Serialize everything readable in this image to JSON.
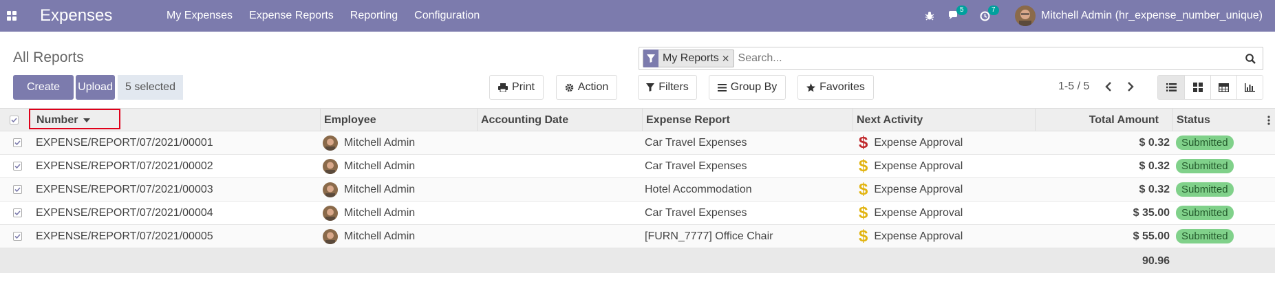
{
  "app": {
    "title": "Expenses"
  },
  "menu": [
    {
      "label": "My Expenses"
    },
    {
      "label": "Expense Reports"
    },
    {
      "label": "Reporting"
    },
    {
      "label": "Configuration"
    }
  ],
  "nav": {
    "messages_count": "5",
    "activities_count": "7",
    "user_name": "Mitchell Admin (hr_expense_number_unique)"
  },
  "control": {
    "breadcrumb": "All Reports",
    "create_label": "Create",
    "upload_label": "Upload",
    "selected_label": "5 selected",
    "print_label": "Print",
    "action_label": "Action",
    "filters_label": "Filters",
    "groupby_label": "Group By",
    "favorites_label": "Favorites",
    "pager": "1-5 / 5"
  },
  "search": {
    "facet_label": "My Reports",
    "placeholder": "Search..."
  },
  "table": {
    "columns": {
      "number": "Number",
      "employee": "Employee",
      "accounting_date": "Accounting Date",
      "expense_report": "Expense Report",
      "next_activity": "Next Activity",
      "total_amount": "Total Amount",
      "status": "Status"
    },
    "rows": [
      {
        "number": "EXPENSE/REPORT/07/2021/00001",
        "employee": "Mitchell Admin",
        "accounting_date": "",
        "expense_report": "Car Travel Expenses",
        "activity": "Expense Approval",
        "activity_color": "#c0282b",
        "amount": "$ 0.32",
        "status": "Submitted"
      },
      {
        "number": "EXPENSE/REPORT/07/2021/00002",
        "employee": "Mitchell Admin",
        "accounting_date": "",
        "expense_report": "Car Travel Expenses",
        "activity": "Expense Approval",
        "activity_color": "#e2b410",
        "amount": "$ 0.32",
        "status": "Submitted"
      },
      {
        "number": "EXPENSE/REPORT/07/2021/00003",
        "employee": "Mitchell Admin",
        "accounting_date": "",
        "expense_report": "Hotel Accommodation",
        "activity": "Expense Approval",
        "activity_color": "#e2b410",
        "amount": "$ 0.32",
        "status": "Submitted"
      },
      {
        "number": "EXPENSE/REPORT/07/2021/00004",
        "employee": "Mitchell Admin",
        "accounting_date": "",
        "expense_report": "Car Travel Expenses",
        "activity": "Expense Approval",
        "activity_color": "#e2b410",
        "amount": "$ 35.00",
        "status": "Submitted"
      },
      {
        "number": "EXPENSE/REPORT/07/2021/00005",
        "employee": "Mitchell Admin",
        "accounting_date": "",
        "expense_report": "[FURN_7777] Office Chair",
        "activity": "Expense Approval",
        "activity_color": "#e2b410",
        "amount": "$ 55.00",
        "status": "Submitted"
      }
    ],
    "total": "90.96"
  },
  "colors": {
    "brand": "#7c7bad",
    "status_green": "#80d18a",
    "highlight": "#e0001a"
  }
}
